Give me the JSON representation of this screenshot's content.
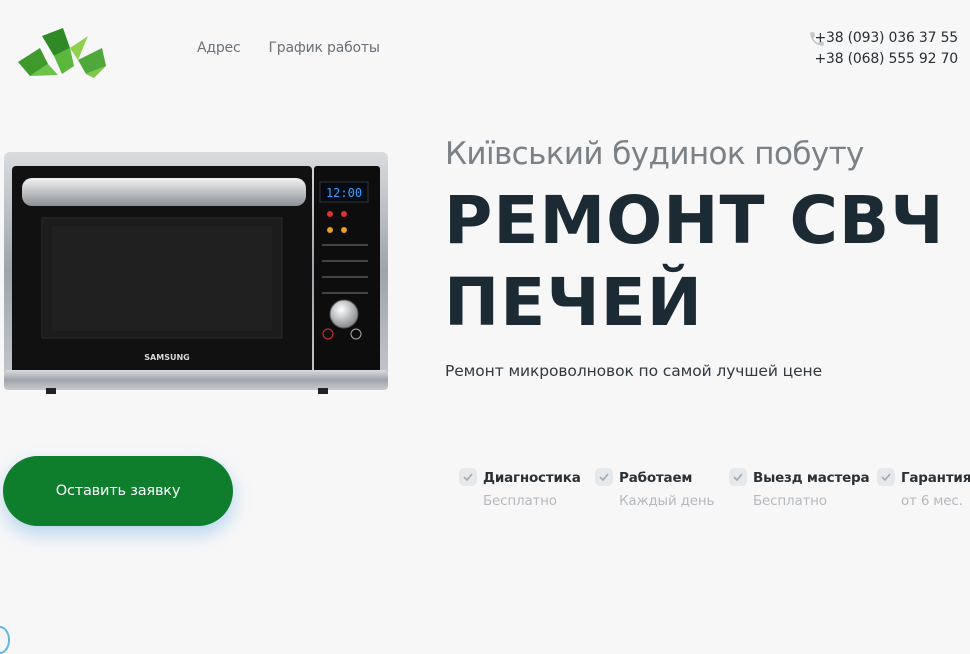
{
  "nav": {
    "items": [
      "Адрес",
      "График работы"
    ]
  },
  "contacts": {
    "phones": [
      "+38 (093) 036 37 55",
      "+38 (068) 555 92 70"
    ]
  },
  "hero": {
    "subtitle": "Київський будинок побуту",
    "title_line1": "РЕМОНТ СВЧ",
    "title_line2": "ПЕЧЕЙ",
    "tagline": "Ремонт микроволновок по самой лучшей цене",
    "cta_label": "Оставить заявку"
  },
  "product": {
    "display_time": "12:00",
    "brand": "SAMSUNG"
  },
  "features": [
    {
      "title": "Диагностика",
      "subtitle": "Бесплатно"
    },
    {
      "title": "Работаем",
      "subtitle": "Каждый день"
    },
    {
      "title": "Выезд мастера",
      "subtitle": "Бесплатно"
    },
    {
      "title": "Гарантия",
      "subtitle": "от 6 мес."
    }
  ],
  "colors": {
    "brand_green": "#0e7d2c",
    "logo_green": "#4caf3a",
    "heading": "#1c2b33",
    "muted": "#7a8187"
  },
  "icons": {
    "logo": "leaf-logo-icon",
    "phone": "phone-icon",
    "check": "check-icon"
  }
}
